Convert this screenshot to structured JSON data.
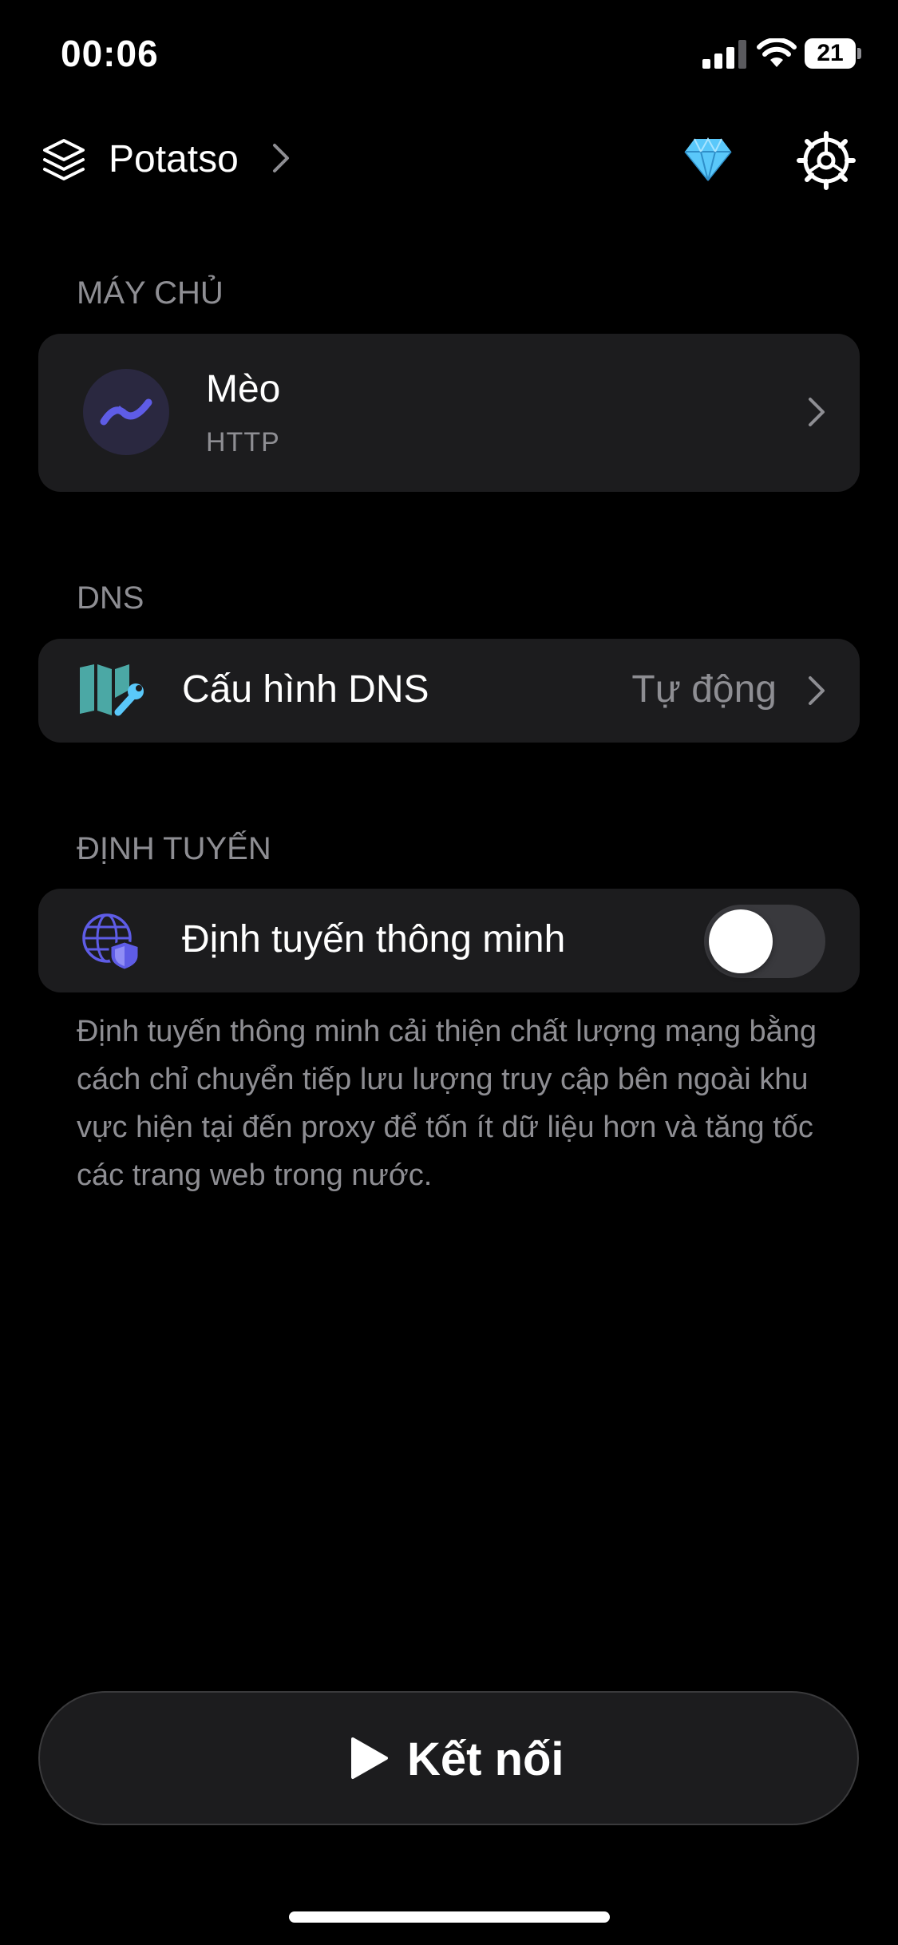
{
  "status_bar": {
    "time": "00:06",
    "battery": "21"
  },
  "header": {
    "title": "Potatso"
  },
  "server_section": {
    "header": "MÁY CHỦ",
    "server": {
      "name": "Mèo",
      "type": "HTTP"
    }
  },
  "dns_section": {
    "header": "DNS",
    "label": "Cấu hình DNS",
    "value": "Tự động"
  },
  "routing_section": {
    "header": "ĐỊNH TUYẾN",
    "label": "Định tuyến thông minh",
    "toggle_on": false,
    "description": "Định tuyến thông minh cải thiện chất lượng mạng bằng cách chỉ chuyển tiếp lưu lượng truy cập bên ngoài khu vực hiện tại đến proxy để tốn ít dữ liệu hơn và tăng tốc các trang web trong nước."
  },
  "connect_button": {
    "label": "Kết nối"
  },
  "icons": {
    "layers": "layers-icon",
    "diamond": "diamond-icon",
    "settings": "gear-icon",
    "server": "wave-icon",
    "dns": "map-wrench-icon",
    "routing": "globe-shield-icon",
    "play": "play-icon"
  },
  "colors": {
    "background": "#000000",
    "card": "#1c1c1e",
    "secondary_text": "#8e8e93",
    "accent_purple": "#5e5ce6",
    "dns_teal": "#4ba8a5",
    "wrench_blue": "#5ac8fa"
  }
}
